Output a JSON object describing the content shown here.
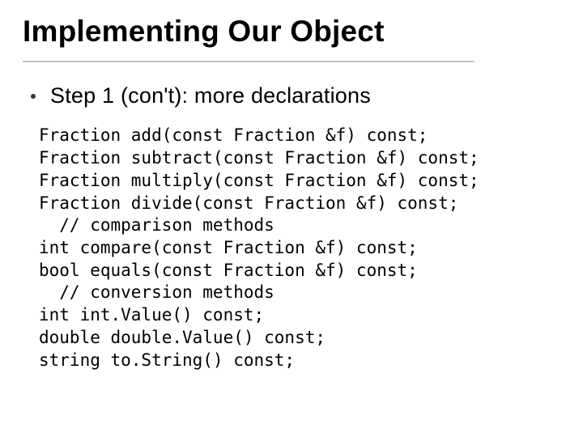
{
  "title": "Implementing Our Object",
  "step": "Step 1 (con't):  more declarations",
  "code_lines": [
    "Fraction add(const Fraction &f) const;",
    "Fraction subtract(const Fraction &f) const;",
    "Fraction multiply(const Fraction &f) const;",
    "Fraction divide(const Fraction &f) const;",
    "  // comparison methods",
    "int compare(const Fraction &f) const;",
    "bool equals(const Fraction &f) const;",
    "  // conversion methods",
    "int int.Value() const;",
    "double double.Value() const;",
    "string to.String() const;"
  ]
}
